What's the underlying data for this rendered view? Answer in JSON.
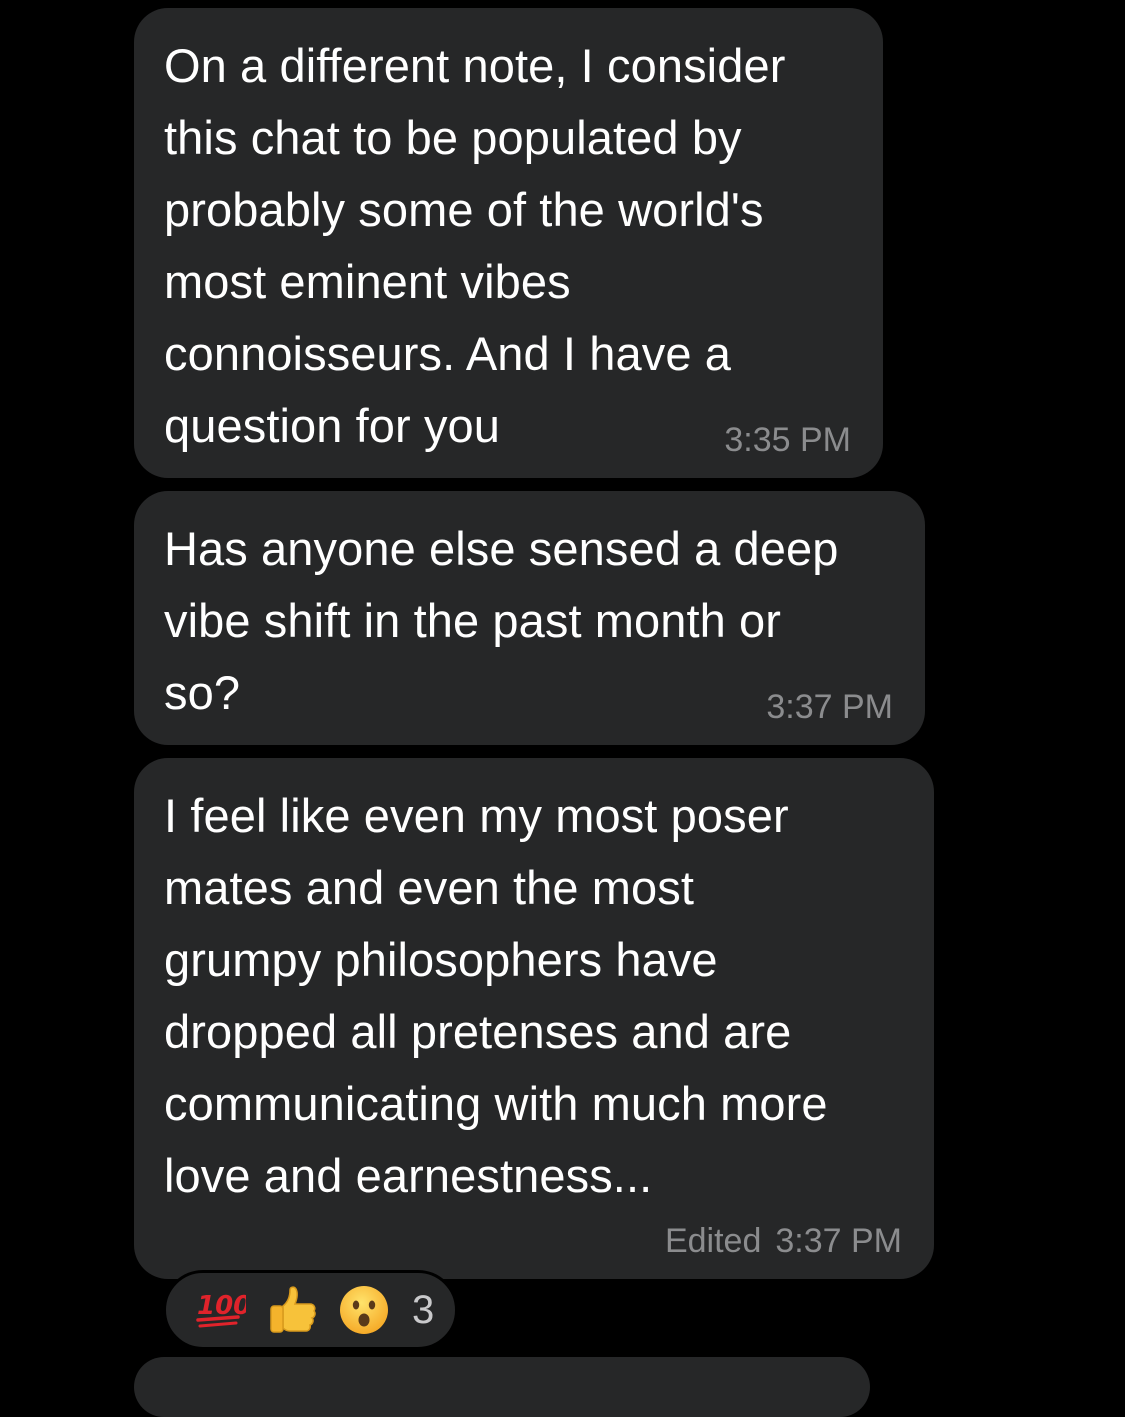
{
  "messages": [
    {
      "text": "On a different note, I consider\nthis chat to be populated by\nprobably some of the world's\nmost eminent vibes\nconnoisseurs. And I have a\nquestion for you",
      "time": "3:35 PM"
    },
    {
      "text": "Has anyone else sensed a deep\nvibe shift in the past month or\nso?",
      "time": "3:37 PM"
    },
    {
      "text": "I feel like even my most poser\nmates and even the most\ngrumpy philosophers have\ndropped all pretenses and are\ncommunicating with much more\nlove and earnestness...",
      "edited": "Edited",
      "time": "3:37 PM"
    }
  ],
  "reactions": {
    "emojis": [
      "hundred-points-icon",
      "thumbs-up-icon",
      "surprised-face-icon"
    ],
    "count": "3"
  },
  "colors": {
    "background": "#000000",
    "bubble": "#262728",
    "text": "#ffffff",
    "meta": "#8b8c8e"
  }
}
